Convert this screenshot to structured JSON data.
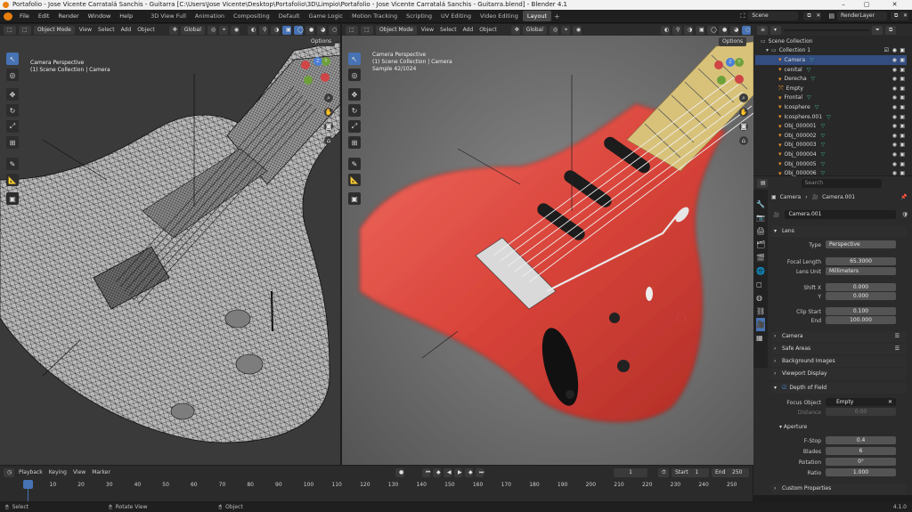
{
  "window": {
    "title": "Portafolio - Jose Vicente Carratalá Sanchis - Guitarra [C:\\Users\\Jose Vicente\\Desktop\\Portafolio\\3D\\Limpio\\Portafolio - Jose Vicente Carratalá Sanchis - Guitarra.blend] - Blender 4.1"
  },
  "menu": [
    "File",
    "Edit",
    "Render",
    "Window",
    "Help"
  ],
  "workspaces": [
    "3D View Full",
    "Animation",
    "Compositing",
    "Default",
    "Game Logic",
    "Motion Tracking",
    "Scripting",
    "UV Editing",
    "Video Editing",
    "Layout"
  ],
  "active_workspace": "Layout",
  "scene": {
    "label": "Scene",
    "view_layer": "RenderLayer"
  },
  "viewport_left": {
    "mode": "Object Mode",
    "menus": [
      "View",
      "Select",
      "Add",
      "Object"
    ],
    "orientation": "Global",
    "options": "Options",
    "overlay_title": "Camera Perspective",
    "overlay_sub": "(1) Scene Collection | Camera"
  },
  "viewport_right": {
    "mode": "Object Mode",
    "menus": [
      "View",
      "Select",
      "Add",
      "Object"
    ],
    "orientation": "Global",
    "options": "Options",
    "overlay_title": "Camera Perspective",
    "overlay_sub": "(1) Scene Collection | Camera",
    "overlay_samples": "Sample 42/1024"
  },
  "outliner": {
    "search_placeholder": "",
    "root": "Scene Collection",
    "collection": "Collection 1",
    "items": [
      "Camera",
      "cenital",
      "Derecha",
      "Empty",
      "Frontal",
      "Icosphere",
      "Icosphere.001",
      "Obj_000001",
      "Obj_000002",
      "Obj_000003",
      "Obj_000004",
      "Obj_000005",
      "Obj_000006"
    ]
  },
  "properties": {
    "search_placeholder": "Search",
    "breadcrumb": [
      "Camera",
      "Camera.001"
    ],
    "datablock": "Camera.001",
    "lens": {
      "header": "Lens",
      "type_label": "Type",
      "type_value": "Perspective",
      "focal_label": "Focal Length",
      "focal_value": "65.3000",
      "unit_label": "Lens Unit",
      "unit_value": "Millimeters",
      "shiftx_label": "Shift X",
      "shiftx_value": "0.000",
      "shifty_label": "Y",
      "shifty_value": "0.000",
      "clipstart_label": "Clip Start",
      "clipstart_value": "0.100",
      "clipend_label": "End",
      "clipend_value": "100.000"
    },
    "panels": {
      "camera": "Camera",
      "safe": "Safe Areas",
      "bg": "Background Images",
      "display": "Viewport Display"
    },
    "dof": {
      "header": "Depth of Field",
      "focus_label": "Focus Object",
      "focus_value": "Empty",
      "distance_label": "Distance",
      "distance_value": "0.00",
      "aperture": "Aperture",
      "fstop_label": "F-Stop",
      "fstop_value": "0.4",
      "blades_label": "Blades",
      "blades_value": "6",
      "rotation_label": "Rotation",
      "rotation_value": "0°",
      "ratio_label": "Ratio",
      "ratio_value": "1.000"
    },
    "custom": "Custom Properties"
  },
  "timeline": {
    "menus": [
      "Playback",
      "Keying",
      "View",
      "Marker"
    ],
    "current_frame": "1",
    "start_label": "Start",
    "start": "1",
    "end_label": "End",
    "end": "250",
    "ticks": [
      "1",
      "10",
      "20",
      "30",
      "40",
      "50",
      "60",
      "70",
      "80",
      "90",
      "100",
      "110",
      "120",
      "130",
      "140",
      "150",
      "160",
      "170",
      "180",
      "190",
      "200",
      "210",
      "220",
      "230",
      "240",
      "250"
    ]
  },
  "statusbar": {
    "select": "Select",
    "rotate": "Rotate View",
    "object": "Object",
    "version": "4.1.0"
  },
  "colors": {
    "accent": "#4772b3",
    "guitar_red": "#c0392b",
    "fretboard": "#d8c27a"
  }
}
